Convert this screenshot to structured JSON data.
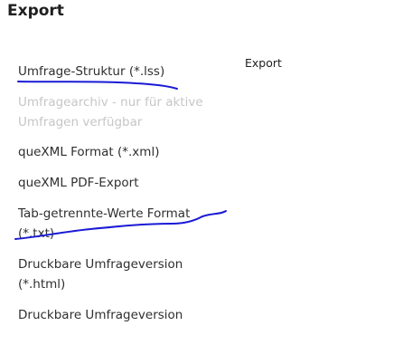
{
  "page": {
    "title": "Export",
    "side_label": "Export"
  },
  "menu": {
    "items": [
      {
        "label": "Umfrage-Struktur (*.lss)",
        "enabled": true
      },
      {
        "label": "Umfragearchiv - nur für aktive Umfragen verfügbar",
        "enabled": false
      },
      {
        "label": "queXML Format (*.xml)",
        "enabled": true
      },
      {
        "label": "queXML PDF-Export",
        "enabled": true
      },
      {
        "label": "Tab-getrennte-Werte Format (*.txt)",
        "enabled": true
      },
      {
        "label": "Druckbare Umfrageversion (*.html)",
        "enabled": true
      },
      {
        "label": "Druckbare Umfrageversion",
        "enabled": true
      }
    ]
  },
  "annotations": {
    "ink_color": "#1a1ad6"
  }
}
